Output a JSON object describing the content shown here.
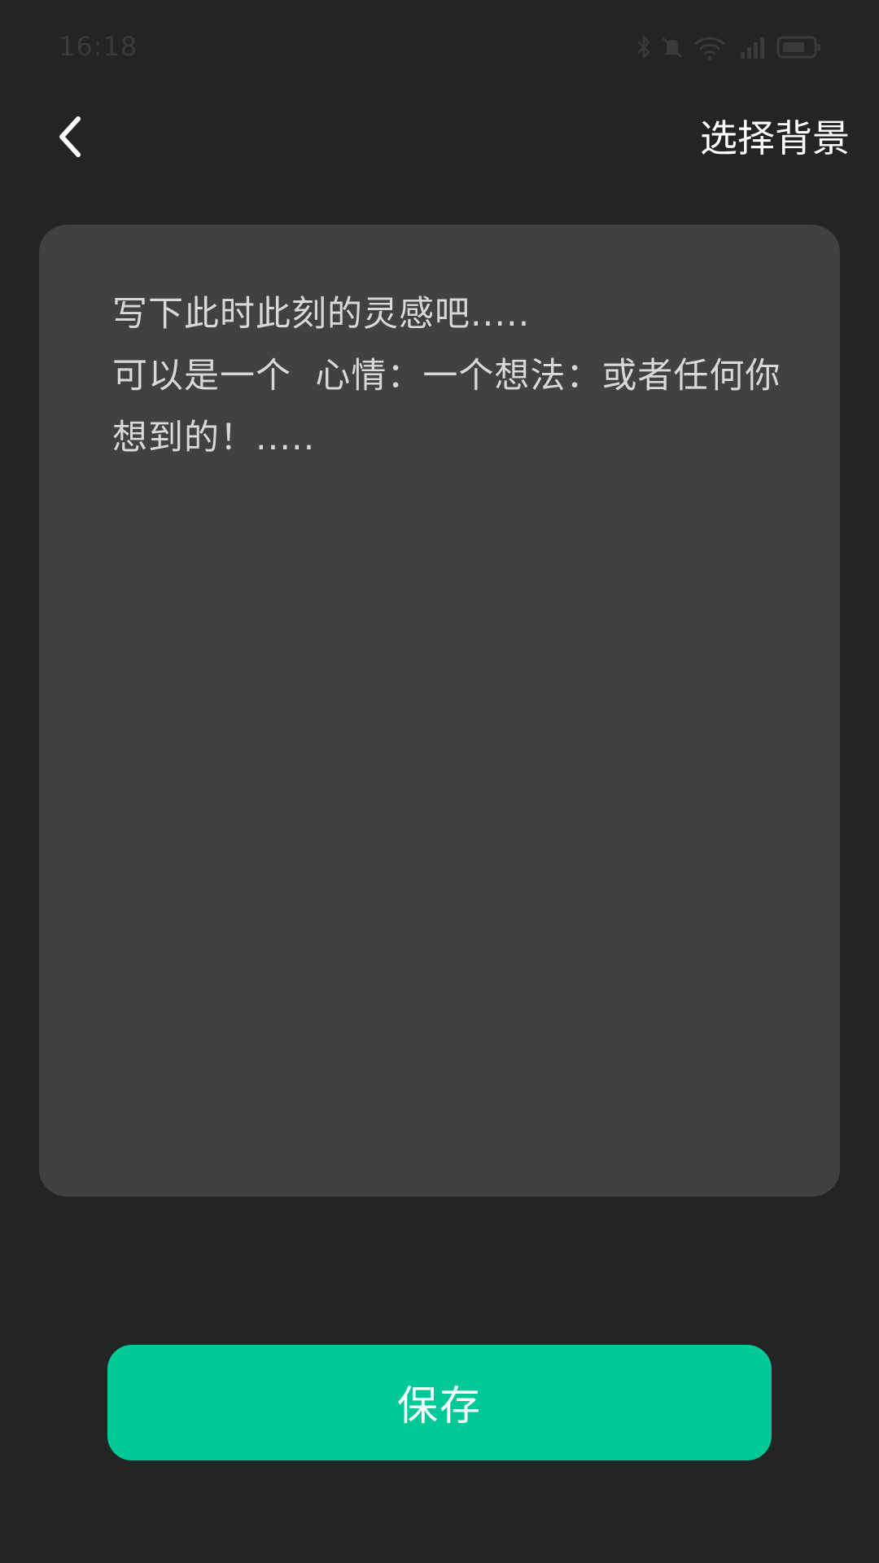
{
  "status_bar": {
    "time": "16:18",
    "icons": [
      "bluetooth-icon",
      "mute-icon",
      "wifi-icon",
      "signal-icon",
      "battery-icon"
    ]
  },
  "header": {
    "back_icon": "chevron-left-icon",
    "choose_background_label": "选择背景"
  },
  "editor": {
    "placeholder": "写下此时此刻的灵感吧.....\n可以是一个  心情：一个想法：或者任何你想到的！....."
  },
  "actions": {
    "save_label": "保存"
  },
  "colors": {
    "background": "#242424",
    "card": "#414141",
    "accent": "#00c897",
    "text": "#ffffff",
    "placeholder_text": "#d8d8d8"
  }
}
